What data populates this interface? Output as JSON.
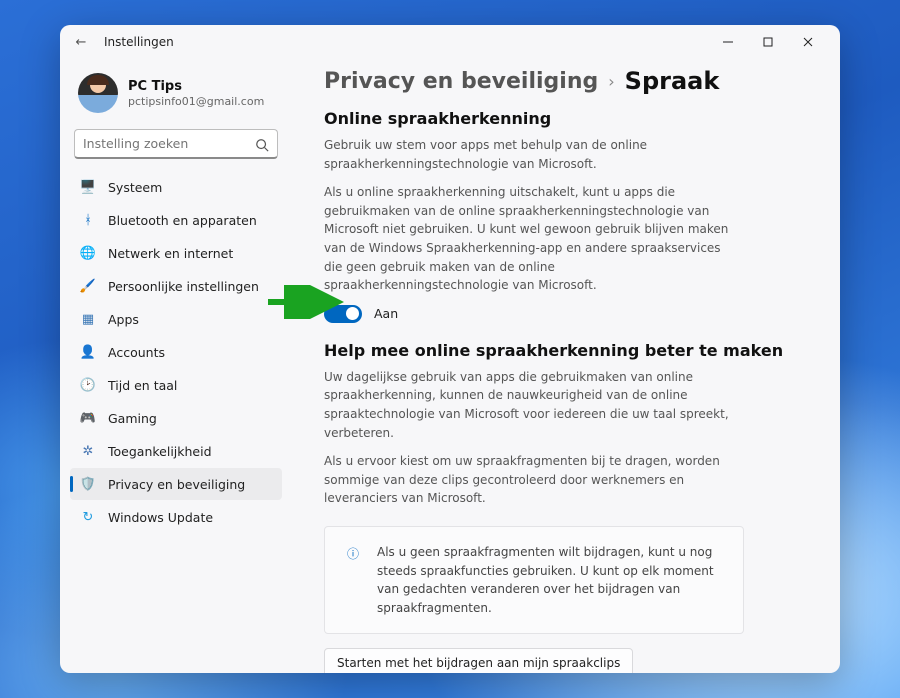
{
  "window": {
    "title": "Instellingen"
  },
  "profile": {
    "name": "PC Tips",
    "email": "pctipsinfo01@gmail.com"
  },
  "search": {
    "placeholder": "Instelling zoeken"
  },
  "nav": {
    "items": [
      {
        "icon": "🖥️",
        "label": "Systeem"
      },
      {
        "icon": "ᚼ",
        "label": "Bluetooth en apparaten",
        "iconColor": "#0067c0"
      },
      {
        "icon": "🌐",
        "label": "Netwerk en internet",
        "iconColor": "#1f9bdf"
      },
      {
        "icon": "🖌️",
        "label": "Persoonlijke instellingen"
      },
      {
        "icon": "▦",
        "label": "Apps",
        "iconColor": "#3b78b6"
      },
      {
        "icon": "👤",
        "label": "Accounts",
        "iconColor": "#e0a24a"
      },
      {
        "icon": "🕑",
        "label": "Tijd en taal",
        "iconColor": "#4aa1c9"
      },
      {
        "icon": "🎮",
        "label": "Gaming",
        "iconColor": "#5f6c73"
      },
      {
        "icon": "✲",
        "label": "Toegankelijkheid",
        "iconColor": "#4a78b4"
      },
      {
        "icon": "🛡️",
        "label": "Privacy en beveiliging",
        "iconColor": "#6b7ca0"
      },
      {
        "icon": "↻",
        "label": "Windows Update",
        "iconColor": "#1f9bdf"
      }
    ],
    "selectedIndex": 9
  },
  "breadcrumb": {
    "parent": "Privacy en beveiliging",
    "current": "Spraak"
  },
  "section1": {
    "title": "Online spraakherkenning",
    "p1": "Gebruik uw stem voor apps met behulp van de online spraakherkenningstechnologie van Microsoft.",
    "p2": "Als u online spraakherkenning uitschakelt, kunt u apps die gebruikmaken van de online spraakherkenningstechnologie van Microsoft niet gebruiken. U kunt wel gewoon gebruik blijven maken van de Windows Spraakherkenning-app en andere spraakservices die geen gebruik maken van de online spraakherkenningstechnologie van Microsoft.",
    "toggle": {
      "state": "on",
      "label": "Aan"
    }
  },
  "section2": {
    "title": "Help mee online spraakherkenning beter te maken",
    "p1": "Uw dagelijkse gebruik van apps die gebruikmaken van online spraakherkenning, kunnen de nauwkeurigheid van de online spraaktechnologie van Microsoft voor iedereen die uw taal spreekt, verbeteren.",
    "p2": "Als u ervoor kiest om uw spraakfragmenten bij te dragen, worden sommige van deze clips gecontroleerd door werknemers en leveranciers van Microsoft.",
    "info": "Als u geen spraakfragmenten wilt bijdragen, kunt u nog steeds spraakfuncties gebruiken. U kunt op elk moment van gedachten veranderen over het bijdragen van spraakfragmenten.",
    "button": "Starten met het bijdragen aan mijn spraakclips"
  },
  "colors": {
    "accent": "#0067c0",
    "arrow": "#1aa321"
  }
}
